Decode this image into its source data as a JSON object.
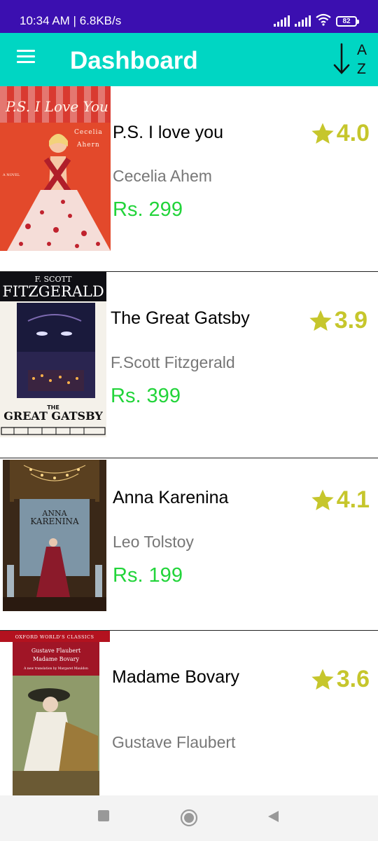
{
  "status_bar": {
    "time": "10:34 AM | 6.8KB/s",
    "battery": "82"
  },
  "app_bar": {
    "title": "Dashboard",
    "sort_label_a": "A",
    "sort_label_z": "Z"
  },
  "books": [
    {
      "title": "P.S. I love you",
      "author": "Cecelia Ahem",
      "price": "Rs. 299",
      "rating": "4.0",
      "cover": {
        "header": "P.S. I Love You",
        "line1": "Cecelia",
        "line2": "Ahern",
        "side": "A NOVEL"
      }
    },
    {
      "title": "The Great Gatsby",
      "author": "F.Scott Fitzgerald",
      "price": "Rs. 399",
      "rating": "3.9",
      "cover": {
        "header": "F. SCOTT",
        "line1": "FITZGERALD",
        "line2": "THE",
        "side": "GREAT GATSBY"
      }
    },
    {
      "title": "Anna Karenina",
      "author": "Leo Tolstoy",
      "price": "Rs. 199",
      "rating": "4.1",
      "cover": {
        "header": "ANNA",
        "line1": "KARENINA",
        "line2": "",
        "side": ""
      }
    },
    {
      "title": "Madame Bovary",
      "author": "Gustave Flaubert",
      "price": "",
      "rating": "3.6",
      "cover": {
        "header": "OXFORD WORLD'S CLASSICS",
        "line1": "Gustave Flaubert",
        "line2": "Madame Bovary",
        "side": "A new translation by Margaret Mauldon"
      }
    }
  ],
  "colors": {
    "status_bar": "#3b0fb0",
    "app_bar": "#00d6c3",
    "price": "#22d43a",
    "rating": "#c6c62c"
  },
  "icons": {
    "menu": "hamburger-icon",
    "sort": "sort-alpha-icon",
    "star": "star-icon",
    "nav_recent": "square-icon",
    "nav_home": "circle-icon",
    "nav_back": "triangle-back-icon"
  }
}
